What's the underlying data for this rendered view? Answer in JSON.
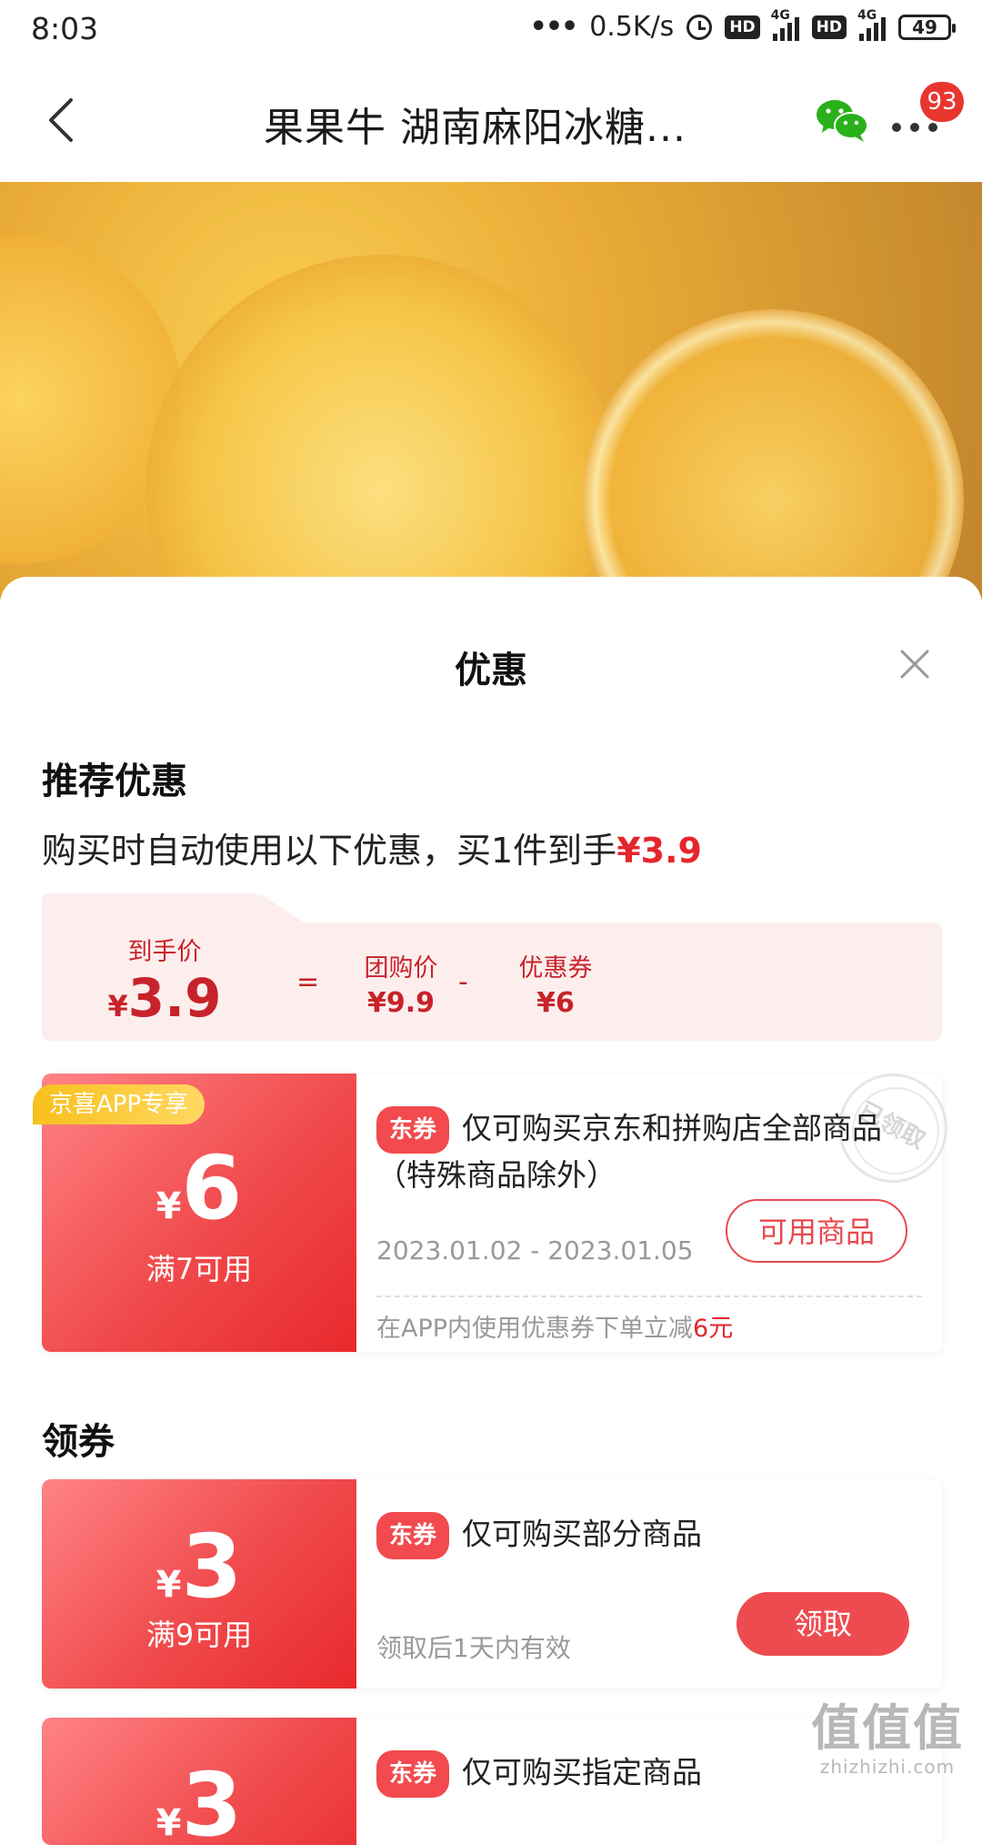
{
  "status_bar": {
    "time": "8:03",
    "network_speed": "0.5K/s",
    "hd1": "HD",
    "hd2": "HD",
    "net1": "4G",
    "net2": "4G",
    "battery": "49"
  },
  "nav": {
    "title": "果果牛 湖南麻阳冰糖...",
    "badge_count": "93",
    "share_icon": "wechat-icon",
    "more_icon": "more-dots-icon"
  },
  "sheet": {
    "title": "优惠",
    "recommend_title": "推荐优惠",
    "recommend_desc": "购买时自动使用以下优惠，买1件到手",
    "recommend_price": "¥3.9",
    "breakdown": {
      "final_label": "到手价",
      "final_currency": "¥",
      "final_value": "3.9",
      "eq": "=",
      "group_label": "团购价",
      "group_value": "¥9.9",
      "minus": "-",
      "coupon_label": "优惠券",
      "coupon_value": "¥6"
    },
    "coupon_section_title": "领券"
  },
  "coupons": [
    {
      "app_tag": "京喜APP专享",
      "currency": "¥",
      "amount": "6",
      "condition": "满7可用",
      "type_tag": "东券",
      "desc": "仅可购买京东和拼购店全部商品（特殊商品除外）",
      "date": "2023.01.02 - 2023.01.05",
      "button": "可用商品",
      "stamp": "已领取",
      "note_prefix": "在APP内使用优惠券下单立减",
      "note_amount": "6元"
    },
    {
      "currency": "¥",
      "amount": "3",
      "condition": "满9可用",
      "type_tag": "东券",
      "desc": "仅可购买部分商品",
      "validity": "领取后1天内有效",
      "button": "领取"
    },
    {
      "currency": "¥",
      "amount": "3",
      "type_tag": "东券",
      "desc": "仅可购买指定商品"
    }
  ],
  "watermark": {
    "mark": "值值值",
    "text": "zhizhizhi.com"
  },
  "colors": {
    "accent_red": "#e4262c",
    "coupon_gradient_start": "#ff8386",
    "coupon_gradient_end": "#e8292c",
    "app_tag_yellow": "#f7c01d",
    "breakdown_bg": "#fdeeee"
  }
}
